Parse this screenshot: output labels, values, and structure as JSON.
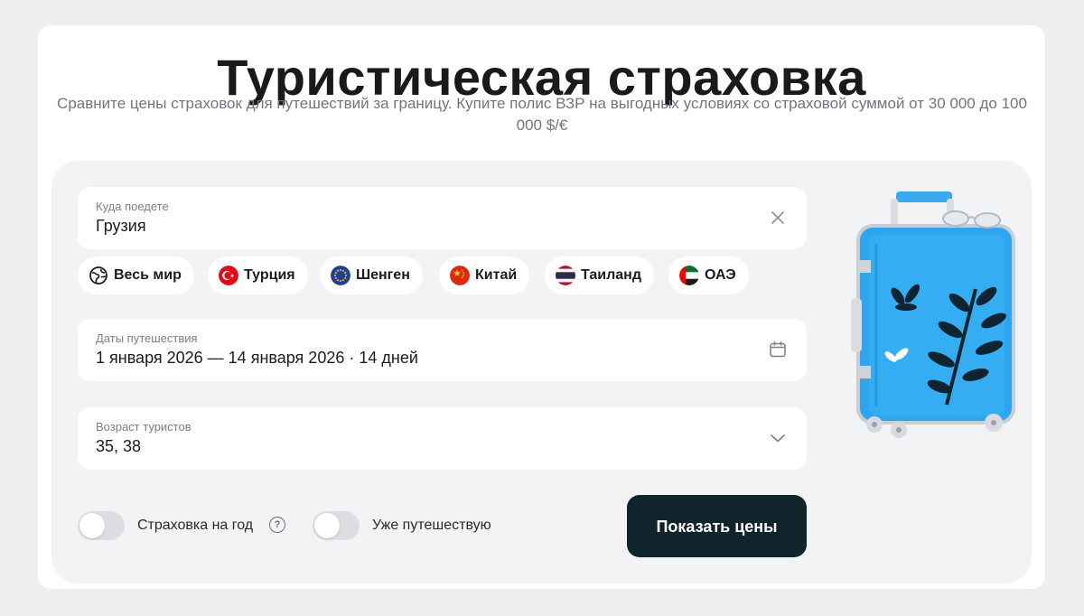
{
  "header": {
    "title": "Туристическая страховка",
    "subtitle": "Сравните цены страховок для путешествий за границу. Купите полис ВЗР на выгодных условиях со страховой суммой от 30 000 до 100 000 $/€"
  },
  "destination": {
    "label": "Куда поедете",
    "value": "Грузия",
    "clear_icon": "close-icon"
  },
  "quick_destinations": [
    {
      "label": "Весь мир",
      "icon": "world-icon"
    },
    {
      "label": "Турция",
      "icon": "flag-turkey-icon"
    },
    {
      "label": "Шенген",
      "icon": "flag-eu-icon"
    },
    {
      "label": "Китай",
      "icon": "flag-china-icon"
    },
    {
      "label": "Таиланд",
      "icon": "flag-thailand-icon"
    },
    {
      "label": "ОАЭ",
      "icon": "flag-uae-icon"
    }
  ],
  "dates": {
    "label": "Даты путешествия",
    "value": "1 января 2026 — 14 января 2026 · 14 дней",
    "icon": "calendar-icon"
  },
  "ages": {
    "label": "Возраст туристов",
    "value": "35, 38",
    "icon": "chevron-down-icon"
  },
  "options": {
    "annual_label": "Страховка на год",
    "annual_on": false,
    "help_glyph": "?",
    "traveling_label": "Уже путешествую",
    "traveling_on": false
  },
  "submit": {
    "label": "Показать цены"
  },
  "colors": {
    "page_bg": "#efefef",
    "panel_bg": "#f2f3f5",
    "cta_bg": "#0f242b",
    "suitcase": "#2ea6ef"
  }
}
